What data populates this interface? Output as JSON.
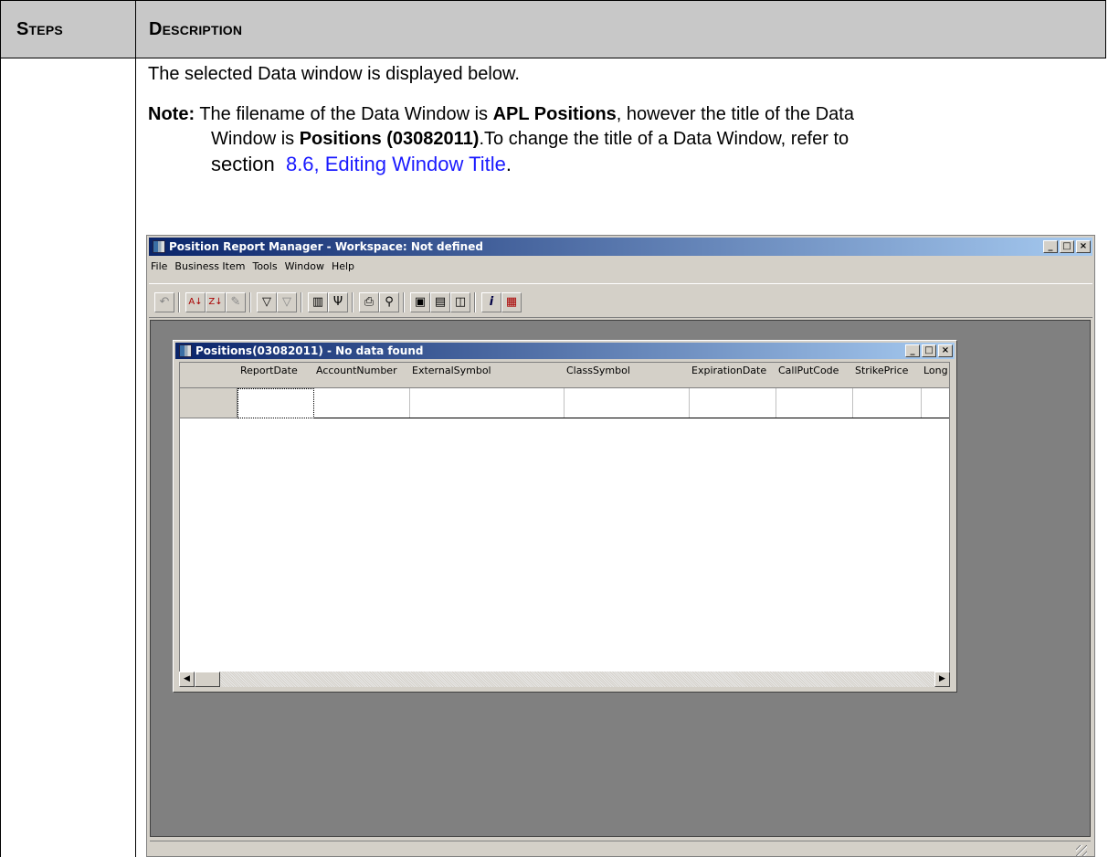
{
  "table": {
    "header_steps": "Steps",
    "header_description": "Description"
  },
  "content": {
    "intro": "The selected Data window is displayed below.",
    "note_label": "Note:",
    "note_part1": "The filename of the Data Window is",
    "note_bold1": "APL Positions",
    "note_part2": ", however the title of the Data",
    "note_part3": "Window is",
    "note_bold2": "Positions (03082011)",
    "note_part4": ".To change the title of a Data Window, refer to",
    "note_part5": "section",
    "note_link": "8.6, Editing Window Title",
    "note_end": "."
  },
  "app": {
    "title": "Position Report Manager - Workspace: Not defined",
    "menu": [
      "File",
      "Business Item",
      "Tools",
      "Window",
      "Help"
    ],
    "minimize": "_",
    "maximize": "□",
    "close": "×",
    "toolbar_icons": [
      "undo-icon",
      "sort-ascending-icon",
      "sort-descending-icon",
      "clear-sort-icon",
      "filter-icon",
      "clear-filter-icon",
      "columns-icon",
      "group-icon",
      "print-icon",
      "find-icon",
      "tile-cascade-icon",
      "tile-horizontal-icon",
      "tile-vertical-icon",
      "info-icon",
      "grid-settings-icon"
    ]
  },
  "child": {
    "title": "Positions(03082011) - No data found",
    "columns": [
      "ReportDate",
      "AccountNumber",
      "ExternalSymbol",
      "ClassSymbol",
      "ExpirationDate",
      "CallPutCode",
      "StrikePrice",
      "Long"
    ],
    "scroll_left": "◀",
    "scroll_right": "▶"
  }
}
